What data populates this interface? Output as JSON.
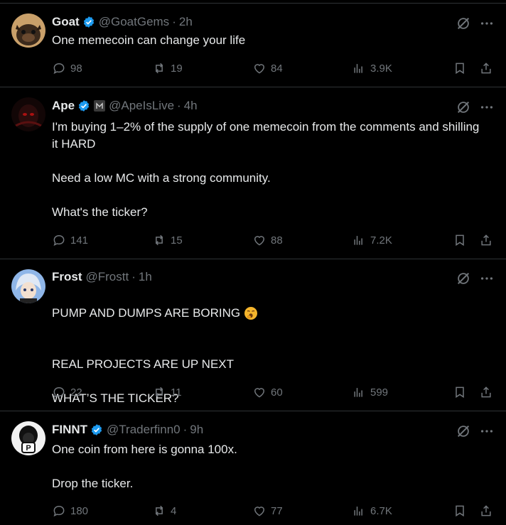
{
  "tweets": [
    {
      "name": "Goat",
      "handle": "@GoatGems",
      "time": "2h",
      "verified": true,
      "text": "One memecoin can change your life",
      "replies": "98",
      "reposts": "19",
      "likes": "84",
      "views": "3.9K"
    },
    {
      "name": "Ape",
      "handle": "@ApeIsLive",
      "time": "4h",
      "verified": true,
      "text": "I'm buying 1–2% of the supply of one memecoin from the comments and shilling it HARD\n\nNeed a low MC with a strong community.\n\nWhat's the ticker?",
      "replies": "141",
      "reposts": "15",
      "likes": "88",
      "views": "7.2K"
    },
    {
      "name": "Frost",
      "handle": "@Frostt",
      "time": "1h",
      "verified": false,
      "text": "PUMP AND DUMPS ARE BORING",
      "text2": "REAL PROJECTS ARE UP NEXT\n\nWHAT’S THE TICKER?",
      "replies": "22",
      "reposts": "11",
      "likes": "60",
      "views": "599"
    },
    {
      "name": "FINNT",
      "handle": "@Traderfinn0",
      "time": "9h",
      "verified": true,
      "text": "One coin from here is gonna 100x.\n\nDrop the ticker.",
      "replies": "180",
      "reposts": "4",
      "likes": "77",
      "views": "6.7K"
    }
  ],
  "icons": {
    "verified_badge": "verified-badge-icon",
    "grok": "grok-icon",
    "more": "more-icon",
    "reply": "reply-icon",
    "repost": "repost-icon",
    "like": "like-icon",
    "views": "views-icon",
    "bookmark": "bookmark-icon",
    "share": "share-icon"
  },
  "colors": {
    "background": "#000000",
    "text": "#e7e9ea",
    "muted": "#71767b",
    "verified": "#1d9bf0",
    "divider": "#2f3336"
  }
}
